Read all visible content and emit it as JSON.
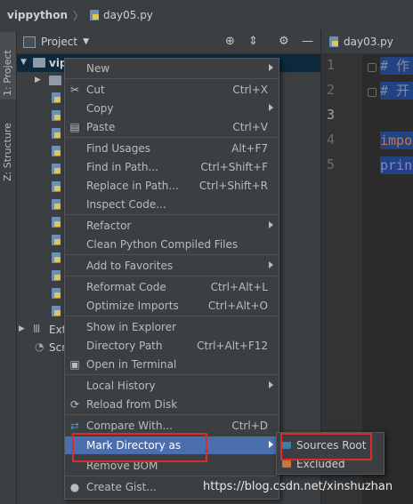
{
  "breadcrumb": {
    "root": "vippython",
    "file": "day05.py"
  },
  "tool_strip": {
    "project_tab": "1: Project",
    "structure_tab": "Z: Structure"
  },
  "panel": {
    "title": "Project"
  },
  "tree": {
    "root_label": "vip",
    "external_label": "Ext",
    "scratches_label": "Scr"
  },
  "editor": {
    "tab": "day03.py",
    "line_numbers": [
      "1",
      "2",
      "3",
      "4",
      "5"
    ],
    "lines": [
      "# 作",
      "# 开",
      "",
      "impo",
      "prin"
    ]
  },
  "menu": {
    "items": [
      {
        "label": "New",
        "shortcut": "",
        "submenu": true
      },
      {
        "label": "Cut",
        "shortcut": "Ctrl+X",
        "icon": "scissors-icon"
      },
      {
        "label": "Copy",
        "shortcut": "",
        "submenu": true
      },
      {
        "label": "Paste",
        "shortcut": "Ctrl+V",
        "icon": "clipboard-icon"
      },
      {
        "label": "Find Usages",
        "shortcut": "Alt+F7"
      },
      {
        "label": "Find in Path...",
        "shortcut": "Ctrl+Shift+F"
      },
      {
        "label": "Replace in Path...",
        "shortcut": "Ctrl+Shift+R"
      },
      {
        "label": "Inspect Code..."
      },
      {
        "label": "Refactor",
        "submenu": true
      },
      {
        "label": "Clean Python Compiled Files"
      },
      {
        "label": "Add to Favorites",
        "submenu": true
      },
      {
        "label": "Reformat Code",
        "shortcut": "Ctrl+Alt+L"
      },
      {
        "label": "Optimize Imports",
        "shortcut": "Ctrl+Alt+O"
      },
      {
        "label": "Show in Explorer"
      },
      {
        "label": "Directory Path",
        "shortcut": "Ctrl+Alt+F12"
      },
      {
        "label": "Open in Terminal",
        "icon": "terminal-icon"
      },
      {
        "label": "Local History",
        "submenu": true
      },
      {
        "label": "Reload from Disk",
        "icon": "reload-icon"
      },
      {
        "label": "Compare With...",
        "shortcut": "Ctrl+D",
        "icon": "compare-icon"
      },
      {
        "label": "Mark Directory as",
        "submenu": true,
        "highlighted": true
      },
      {
        "label": "Remove BOM"
      },
      {
        "label": "Create Gist...",
        "icon": "github-icon"
      }
    ]
  },
  "submenu": {
    "items": [
      {
        "label": "Sources Root",
        "color": "#3d7fa8"
      },
      {
        "label": "Excluded",
        "color": "#c7763e"
      }
    ]
  },
  "colors": {
    "highlight": "#4b6eaf",
    "annotation": "#e0292b"
  },
  "watermark": "https://blog.csdn.net/xinshuzhan"
}
